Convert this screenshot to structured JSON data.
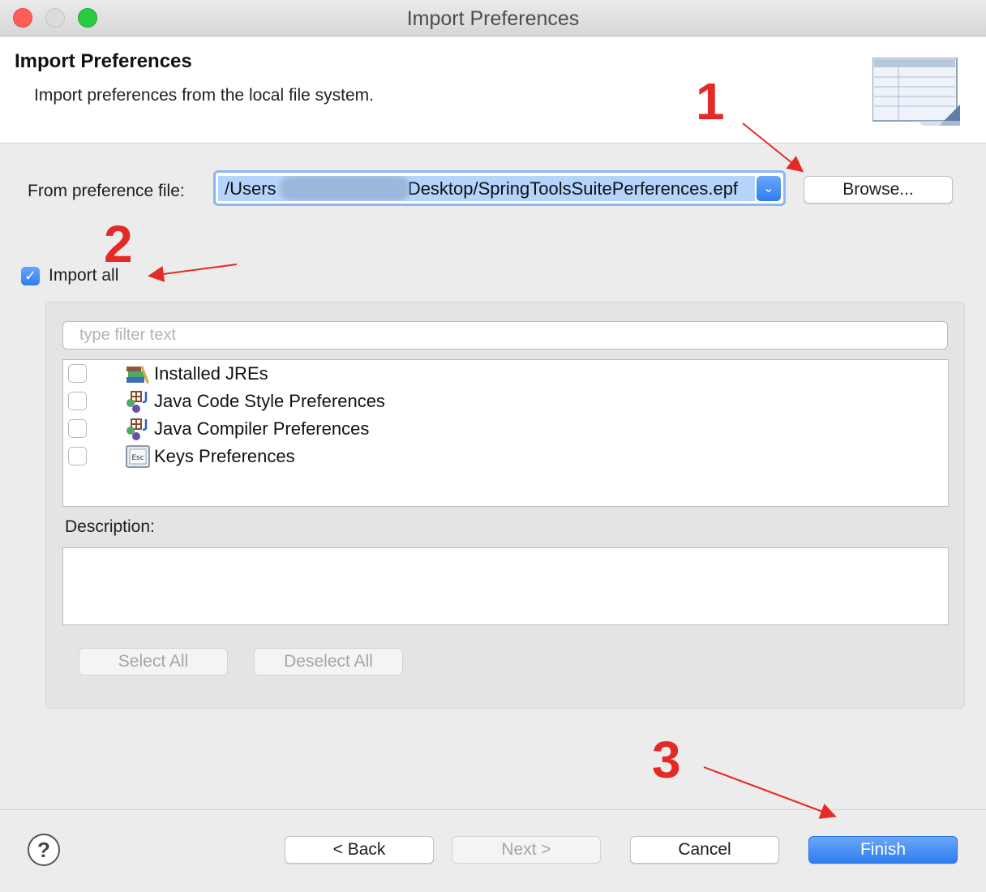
{
  "window": {
    "title": "Import Preferences"
  },
  "header": {
    "title": "Import Preferences",
    "subtitle": "Import preferences from the local file system."
  },
  "file": {
    "label": "From preference file:",
    "path_start": "/Users",
    "path_end": "Desktop/SpringToolsSuitePerferences.epf",
    "browse_label": "Browse..."
  },
  "import_all": {
    "label": "Import all",
    "checked": true
  },
  "filter": {
    "placeholder": "type filter text"
  },
  "items": [
    {
      "label": "Installed JREs",
      "icon": "jre-books-icon",
      "checked": false
    },
    {
      "label": "Java Code Style Preferences",
      "icon": "java-prefs-icon",
      "checked": false
    },
    {
      "label": "Java Compiler Preferences",
      "icon": "java-prefs-icon",
      "checked": false
    },
    {
      "label": "Keys Preferences",
      "icon": "esc-key-icon",
      "checked": false
    }
  ],
  "description": {
    "label": "Description:",
    "text": ""
  },
  "group_buttons": {
    "select_all": "Select All",
    "deselect_all": "Deselect All"
  },
  "footer": {
    "back": "< Back",
    "next": "Next >",
    "cancel": "Cancel",
    "finish": "Finish",
    "help": "?"
  },
  "annotations": {
    "step1": "1",
    "step2": "2",
    "step3": "3"
  },
  "colors": {
    "accent": "#2e7ef0",
    "annotation": "#e42a26",
    "selection": "#b4d4fc"
  }
}
